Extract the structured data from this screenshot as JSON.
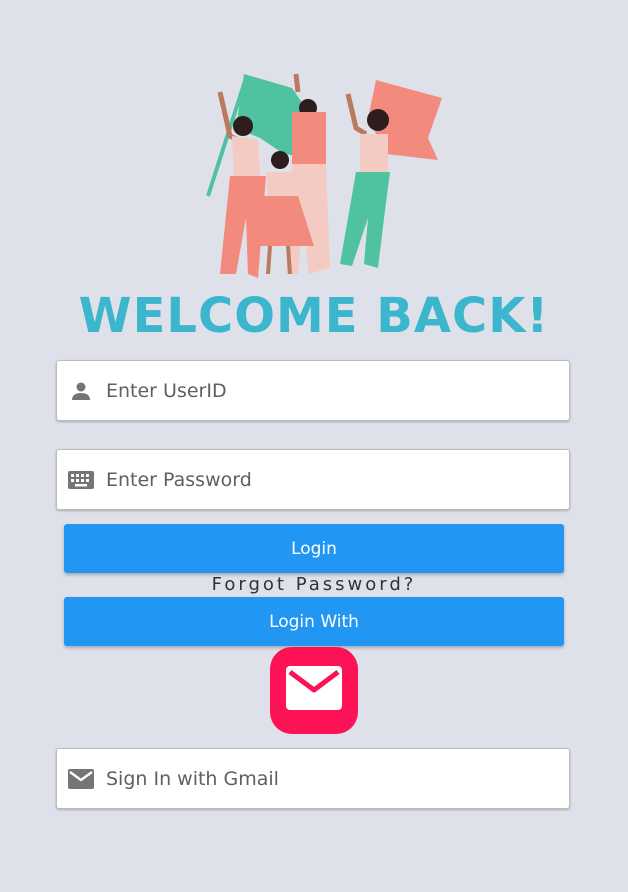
{
  "header": {
    "title": "WELCOME BACK!"
  },
  "illustration": {
    "name": "women-marching-with-flags-illustration",
    "colors": [
      "#f28b7e",
      "#4fc2a0",
      "#f4cbc3"
    ]
  },
  "form": {
    "userid_placeholder": "Enter UserID",
    "userid_icon": "person-icon",
    "password_placeholder": "Enter Password",
    "password_icon": "keyboard-icon",
    "login_label": "Login",
    "forgot_label": "Forgot Password?",
    "login_with_label": "Login With",
    "gmail_tile_icon": "mail-icon",
    "gmail_placeholder": "Sign In with Gmail",
    "gmail_field_icon": "mail-icon"
  },
  "colors": {
    "background": "#dfe1ea",
    "title": "#3bb6cc",
    "button": "#2196f3",
    "gmail_tile": "#fb1356"
  }
}
